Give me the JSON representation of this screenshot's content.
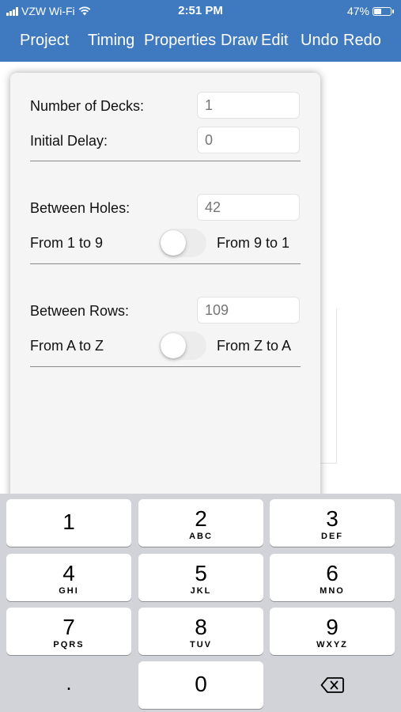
{
  "status": {
    "carrier": "VZW Wi-Fi",
    "time": "2:51 PM",
    "battery": "47%",
    "battery_level": 0.47
  },
  "nav": {
    "project": "Project",
    "timing": "Timing",
    "properties": "Properties",
    "draw": "Draw",
    "edit": "Edit",
    "undo": "Undo",
    "redo": "Redo"
  },
  "panel": {
    "decks_label": "Number of Decks:",
    "decks_placeholder": "1",
    "delay_label": "Initial Delay:",
    "delay_placeholder": "0",
    "holes_label": "Between Holes:",
    "holes_placeholder": "42",
    "holes_left": "From 1 to 9",
    "holes_right": "From 9 to 1",
    "holes_toggle_on": false,
    "rows_label": "Between Rows:",
    "rows_placeholder": "109",
    "rows_left": "From A to Z",
    "rows_right": "From Z to A",
    "rows_toggle_on": false
  },
  "keypad": {
    "keys": [
      {
        "num": "1",
        "sub": ""
      },
      {
        "num": "2",
        "sub": "ABC"
      },
      {
        "num": "3",
        "sub": "DEF"
      },
      {
        "num": "4",
        "sub": "GHI"
      },
      {
        "num": "5",
        "sub": "JKL"
      },
      {
        "num": "6",
        "sub": "MNO"
      },
      {
        "num": "7",
        "sub": "PQRS"
      },
      {
        "num": "8",
        "sub": "TUV"
      },
      {
        "num": "9",
        "sub": "WXYZ"
      },
      {
        "num": "0",
        "sub": ""
      }
    ],
    "dot": ".",
    "delete_icon": "backspace-icon"
  }
}
